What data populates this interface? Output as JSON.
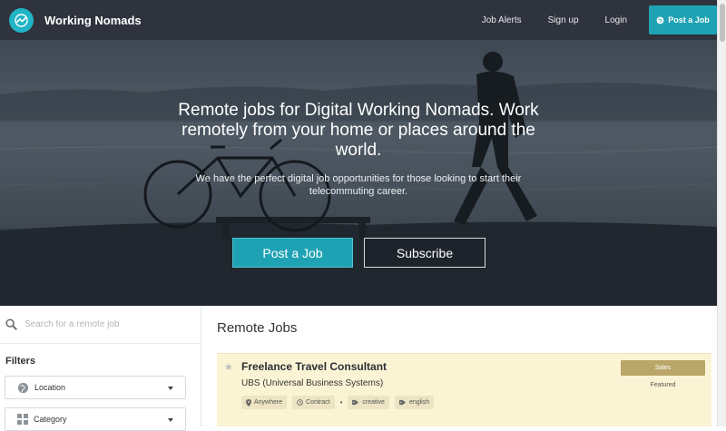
{
  "navbar": {
    "brand": "Working Nomads",
    "links": [
      "Job Alerts",
      "Sign up",
      "Login"
    ],
    "post_button": "Post a Job"
  },
  "hero": {
    "title": "Remote jobs for Digital Working Nomads. Work remotely from your home or places around the world.",
    "subtitle": "We have the perfect digital job opportunities for those looking to start their telecommuting career.",
    "primary_button": "Post a Job",
    "secondary_button": "Subscribe"
  },
  "sidebar": {
    "search_placeholder": "Search for a remote job",
    "filters_title": "Filters",
    "dropdowns": [
      {
        "label": "Location",
        "icon": "globe-icon"
      },
      {
        "label": "Category",
        "icon": "grid-icon"
      }
    ]
  },
  "main": {
    "title": "Remote Jobs",
    "job": {
      "title": "Freelance Travel Consultant",
      "company": "UBS (Universal Business Systems)",
      "tags": [
        {
          "label": "Anywhere",
          "icon": "map-pin-icon"
        },
        {
          "label": "Contract",
          "icon": "clock-icon"
        },
        {
          "label": "creative",
          "icon": "tag-icon"
        },
        {
          "label": "english",
          "icon": "tag-icon"
        }
      ],
      "category_badge": "Sales",
      "status": "Featured"
    }
  },
  "colors": {
    "navbar_bg": "#2e333d",
    "accent": "#1fa3b4",
    "featured_bg": "#fbf4d4",
    "badge": "#b9a668"
  }
}
